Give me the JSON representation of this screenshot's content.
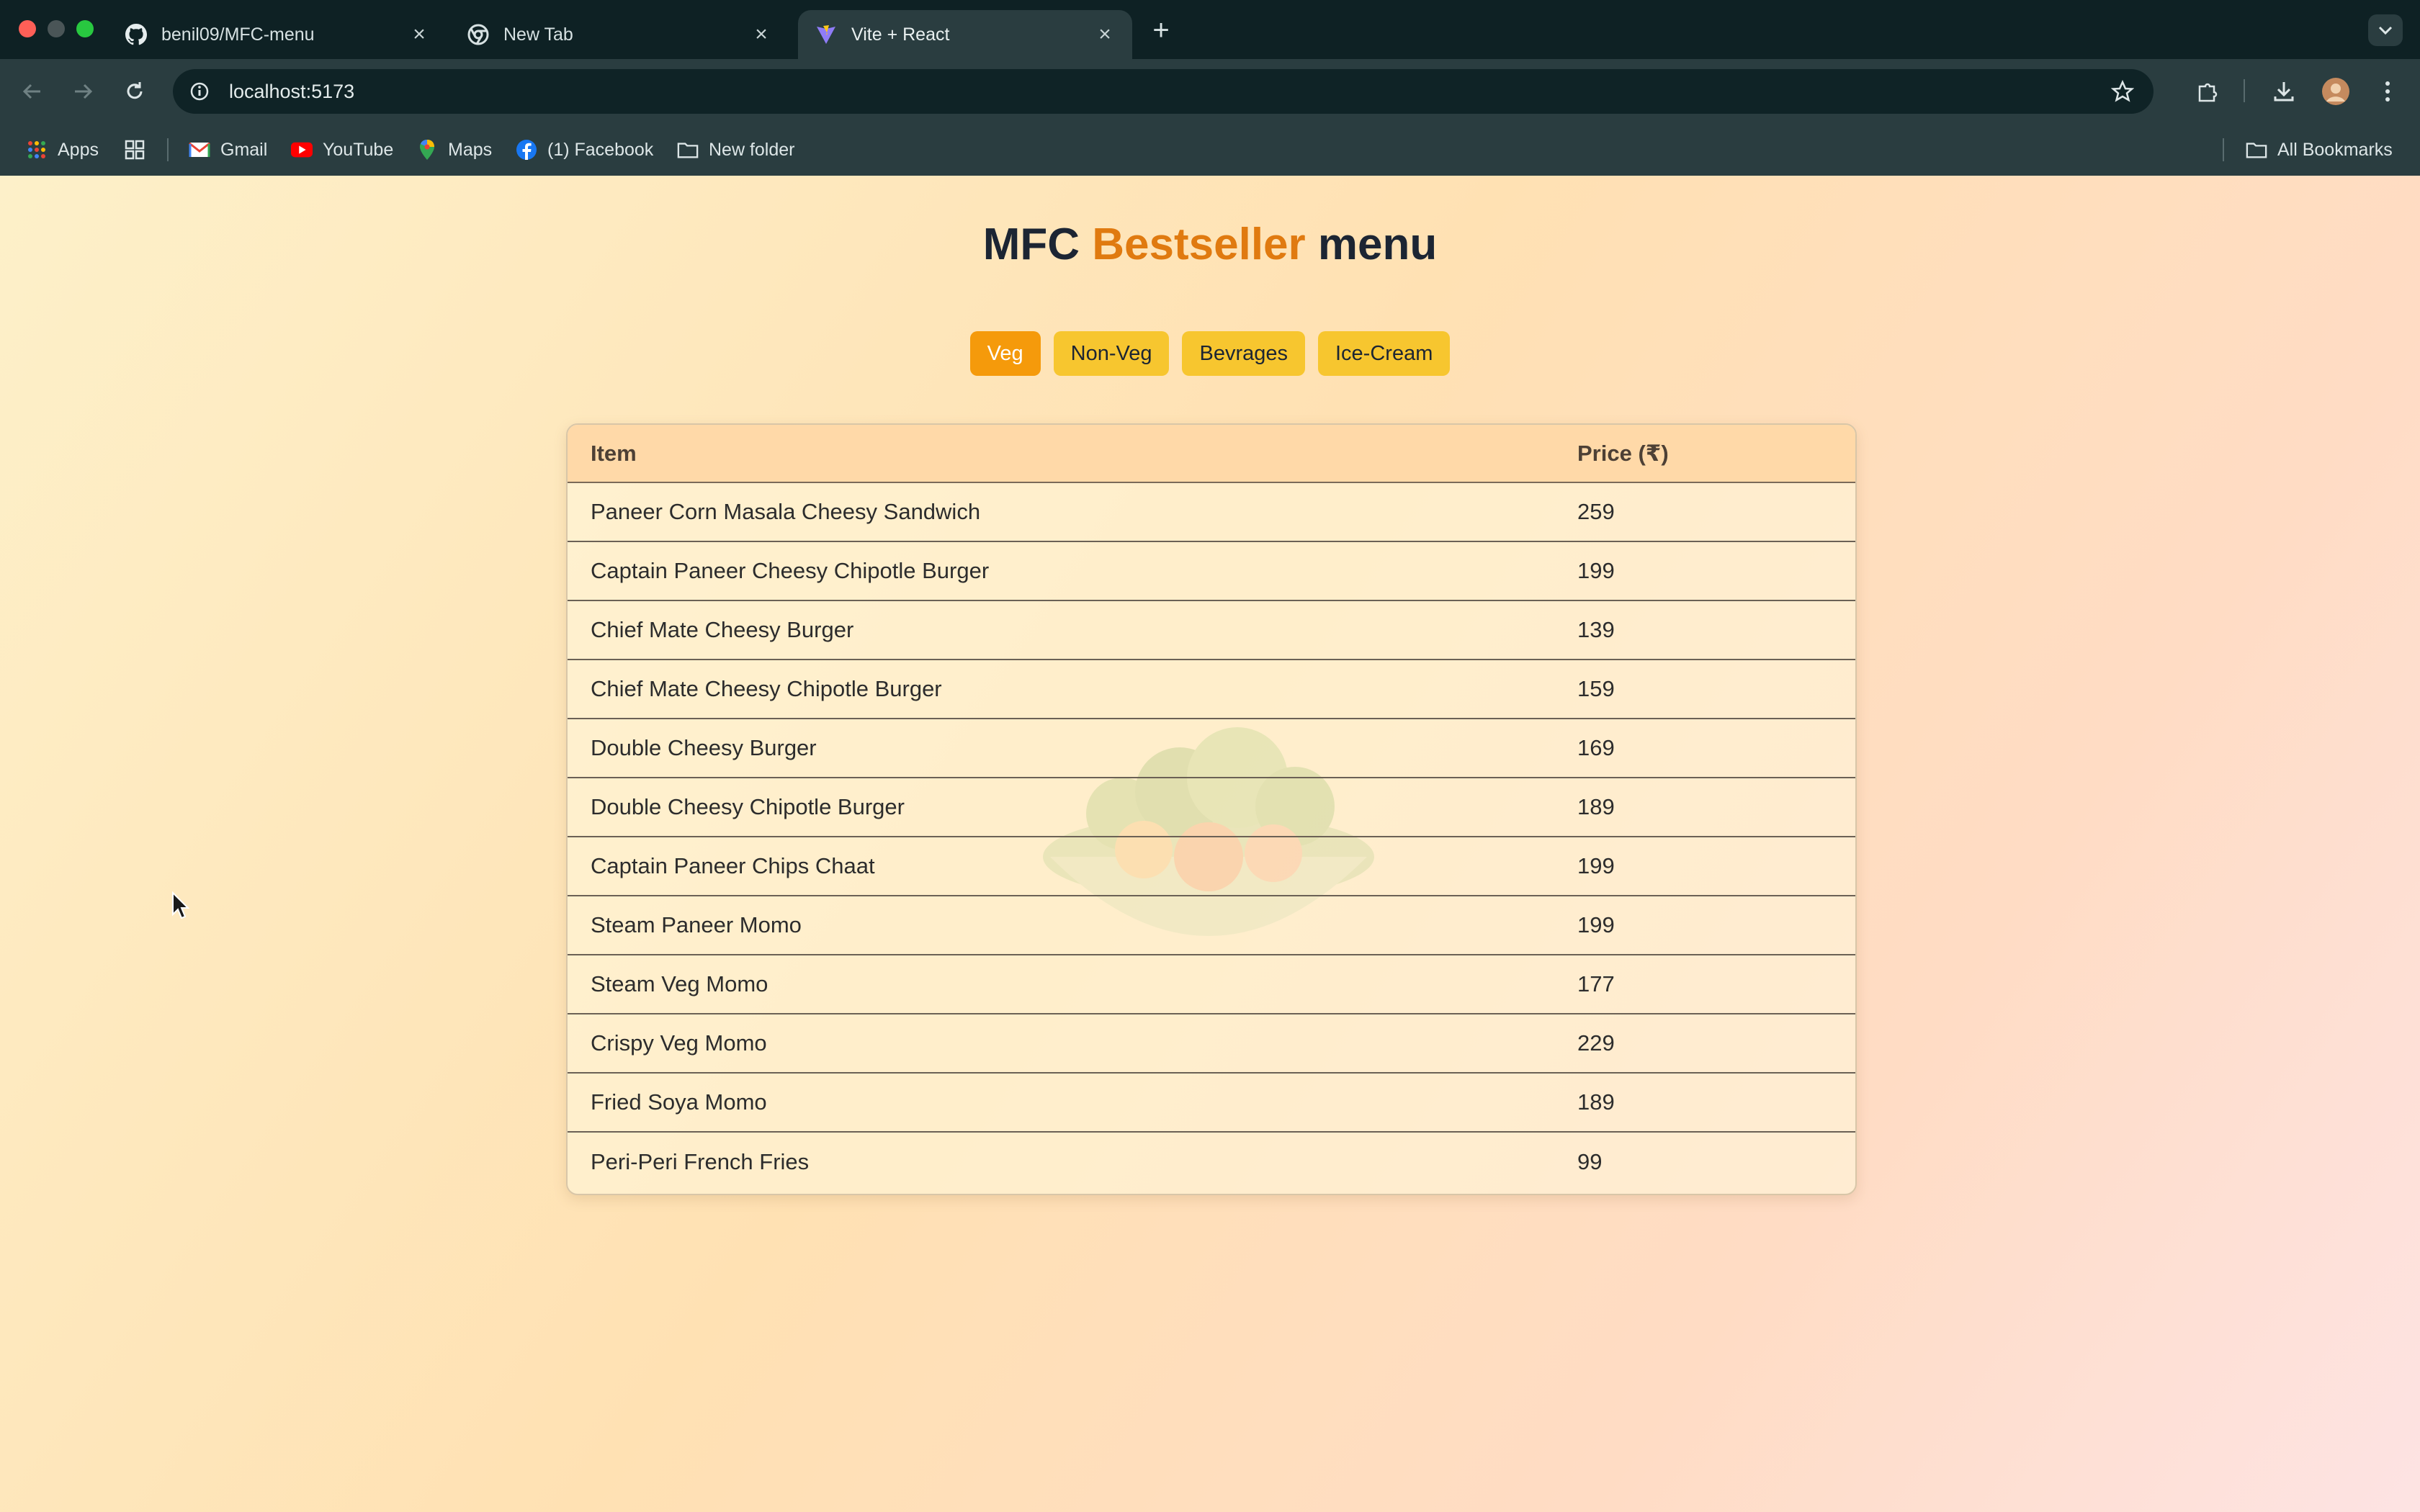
{
  "browser": {
    "tabs": [
      {
        "title": "benil09/MFC-menu",
        "icon": "github-icon",
        "active": false
      },
      {
        "title": "New Tab",
        "icon": "chrome-icon",
        "active": false
      },
      {
        "title": "Vite + React",
        "icon": "vite-icon",
        "active": true
      }
    ],
    "url": "localhost:5173",
    "bookmarks": [
      {
        "label": "Apps",
        "icon": "apps-grid-icon"
      },
      {
        "label": "Gmail",
        "icon": "gmail-icon"
      },
      {
        "label": "YouTube",
        "icon": "youtube-icon"
      },
      {
        "label": "Maps",
        "icon": "maps-icon"
      },
      {
        "label": "(1) Facebook",
        "icon": "facebook-icon"
      },
      {
        "label": "New folder",
        "icon": "folder-icon"
      }
    ],
    "all_bookmarks": "All Bookmarks"
  },
  "page": {
    "title_part1": "MFC",
    "title_accent": "Bestseller",
    "title_part2": "menu",
    "accent_color": "#e07a10",
    "filters": [
      {
        "label": "Veg",
        "active": true
      },
      {
        "label": "Non-Veg",
        "active": false
      },
      {
        "label": "Bevrages",
        "active": false
      },
      {
        "label": "Ice-Cream",
        "active": false
      }
    ],
    "table": {
      "headers": {
        "item": "Item",
        "price": "Price (₹)"
      },
      "rows": [
        {
          "item": "Paneer Corn Masala Cheesy Sandwich",
          "price": "259"
        },
        {
          "item": "Captain Paneer Cheesy Chipotle Burger",
          "price": "199"
        },
        {
          "item": "Chief Mate Cheesy Burger",
          "price": "139"
        },
        {
          "item": "Chief Mate Cheesy Chipotle Burger",
          "price": "159"
        },
        {
          "item": "Double Cheesy Burger",
          "price": "169"
        },
        {
          "item": "Double Cheesy Chipotle Burger",
          "price": "189"
        },
        {
          "item": "Captain Paneer Chips Chaat",
          "price": "199"
        },
        {
          "item": "Steam Paneer Momo",
          "price": "199"
        },
        {
          "item": "Steam Veg Momo",
          "price": "177"
        },
        {
          "item": "Crispy Veg Momo",
          "price": "229"
        },
        {
          "item": "Fried Soya Momo",
          "price": "189"
        },
        {
          "item": "Peri-Peri French Fries",
          "price": "99"
        }
      ]
    }
  }
}
